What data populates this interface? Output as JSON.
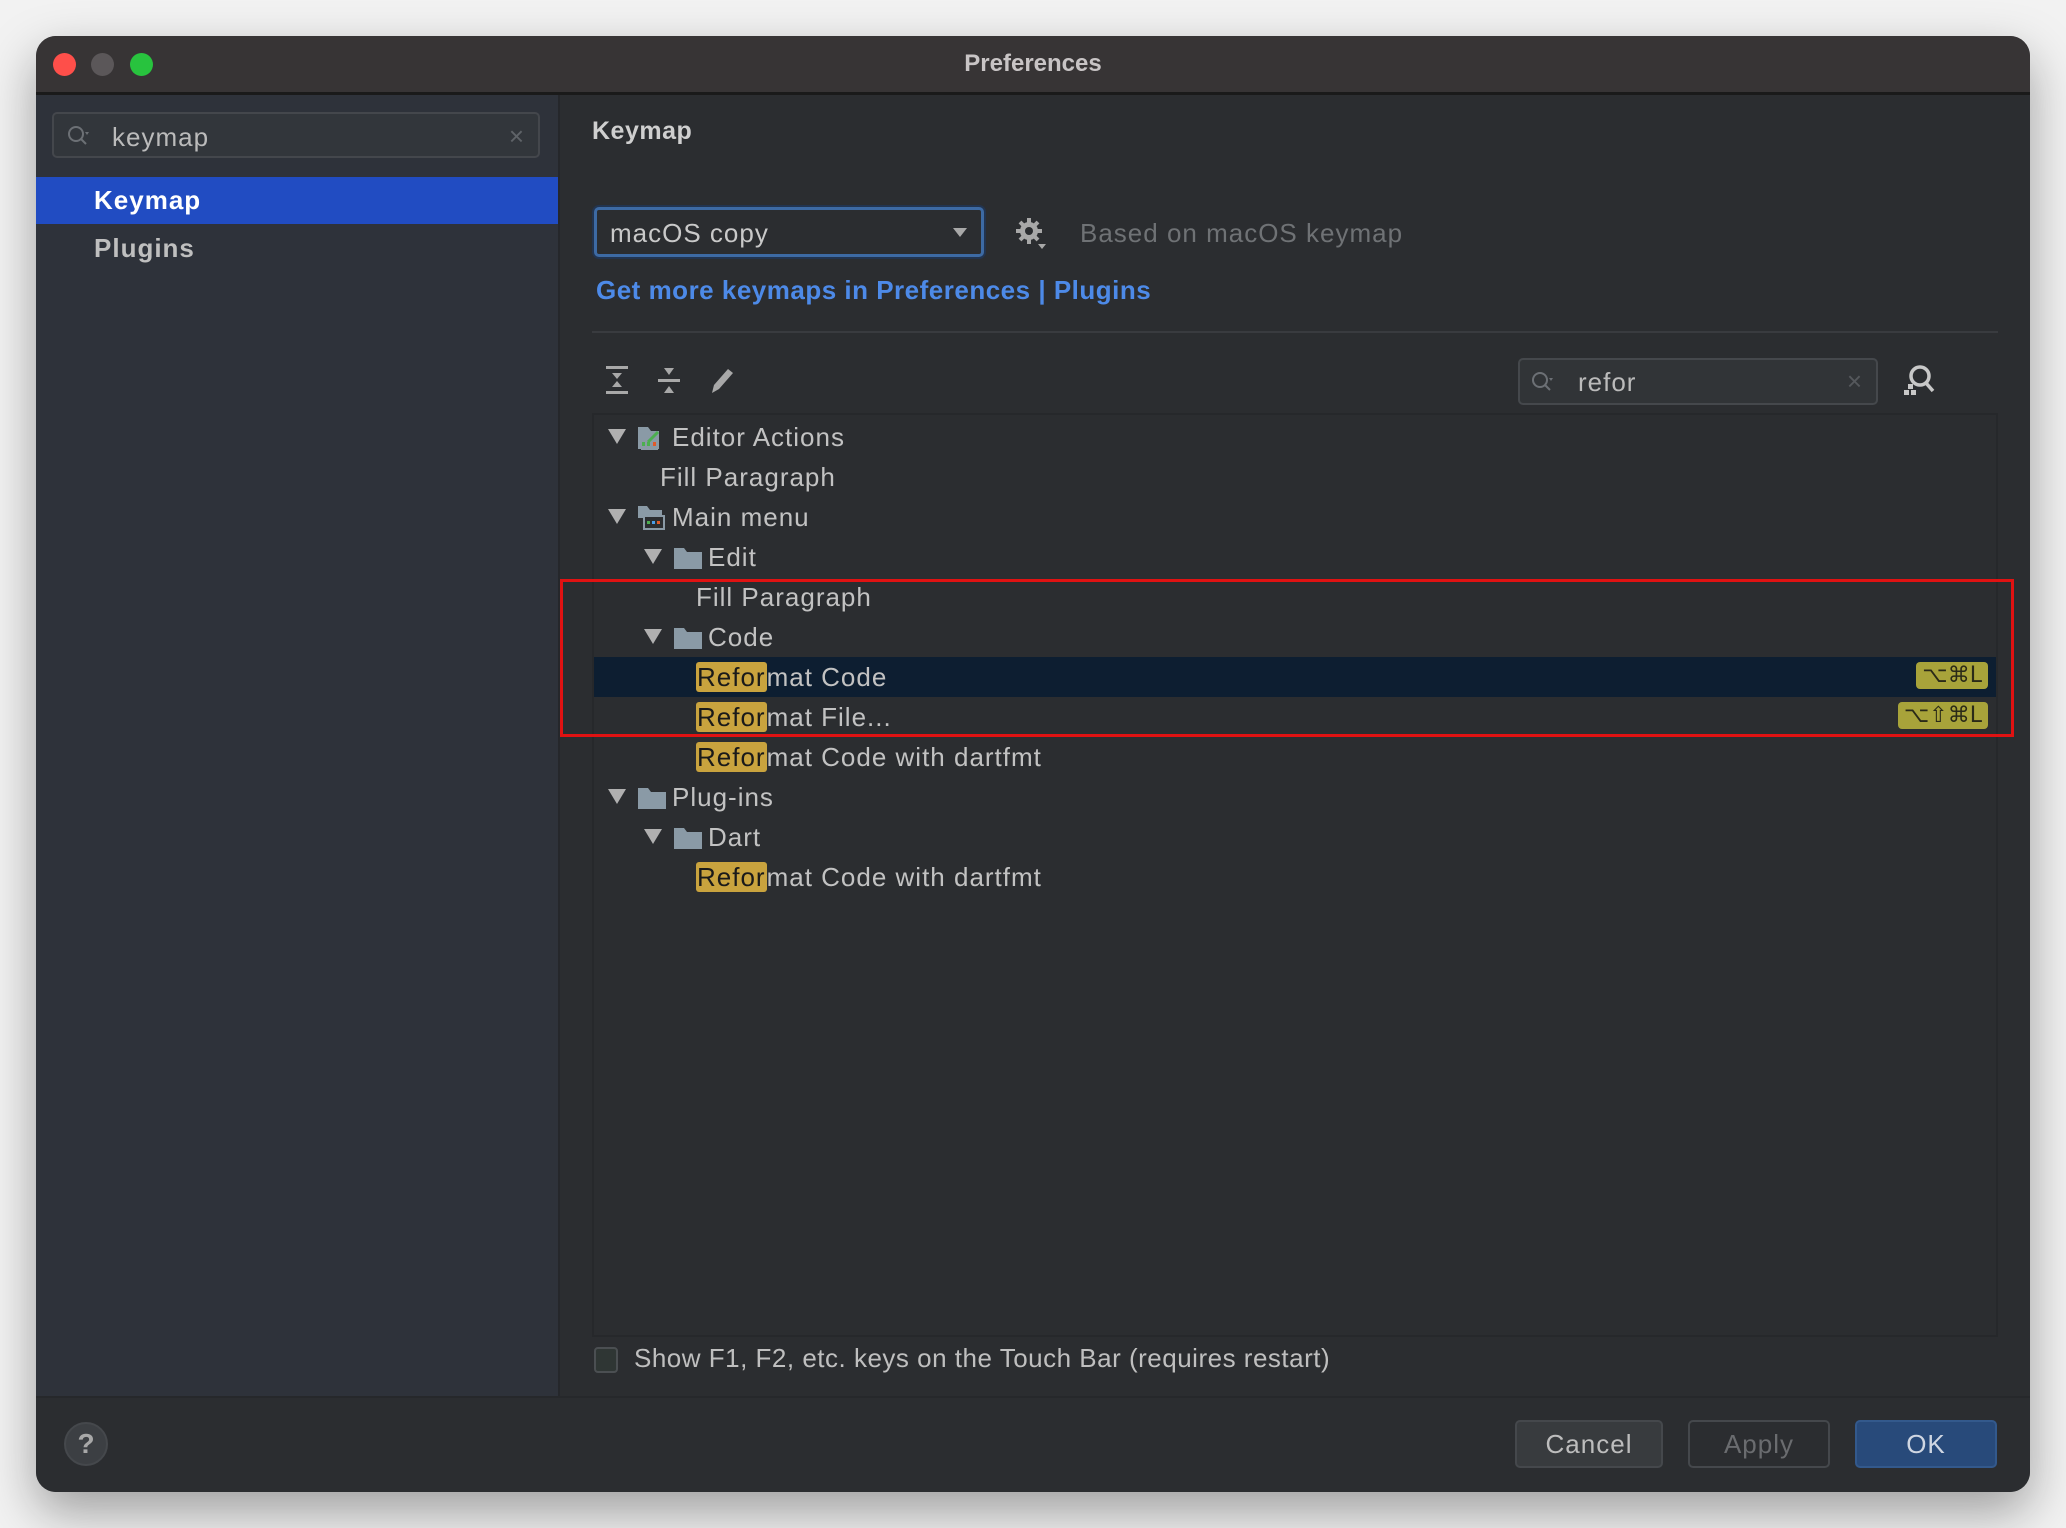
{
  "window": {
    "title": "Preferences"
  },
  "sidebar": {
    "search": {
      "value": "keymap",
      "icon": "search-icon",
      "clear_icon": "×"
    },
    "items": [
      {
        "label": "Keymap",
        "active": true
      },
      {
        "label": "Plugins",
        "active": false
      }
    ]
  },
  "main": {
    "section_title": "Keymap",
    "keymap_select": {
      "value": "macOS copy"
    },
    "gear_icon": "gear-icon",
    "based_on": "Based on macOS keymap",
    "more_link": "Get more keymaps in Preferences | Plugins",
    "toolbar": {
      "expand_all": "expand-all-icon",
      "collapse_all": "collapse-all-icon",
      "edit": "pencil-icon"
    },
    "tree_search": {
      "value": "refor",
      "clear_icon": "×"
    },
    "tree": [
      {
        "label": "Editor Actions",
        "level": 0,
        "type": "group-editor",
        "expanded": true
      },
      {
        "label": "Fill Paragraph",
        "level": 1,
        "type": "action"
      },
      {
        "label": "Main menu",
        "level": 0,
        "type": "group-menu",
        "expanded": true
      },
      {
        "label": "Edit",
        "level": 1,
        "type": "folder",
        "expanded": true
      },
      {
        "label": "Fill Paragraph",
        "level": 2,
        "type": "action"
      },
      {
        "label": "Code",
        "level": 1,
        "type": "folder",
        "expanded": true
      },
      {
        "match": "Refor",
        "rest": "mat Code",
        "level": 2,
        "type": "action",
        "selected": true,
        "shortcut": "⌥⌘L"
      },
      {
        "match": "Refor",
        "rest": "mat File...",
        "level": 2,
        "type": "action",
        "shortcut": "⌥⇧⌘L"
      },
      {
        "match": "Refor",
        "rest": "mat Code with dartfmt",
        "level": 2,
        "type": "action"
      },
      {
        "label": "Plug-ins",
        "level": 0,
        "type": "folder",
        "expanded": true
      },
      {
        "label": "Dart",
        "level": 1,
        "type": "folder",
        "expanded": true
      },
      {
        "match": "Refor",
        "rest": "mat Code with dartfmt",
        "level": 2,
        "type": "action"
      }
    ],
    "touchbar_checkbox": {
      "label": "Show F1, F2, etc. keys on the Touch Bar (requires restart)",
      "checked": false
    }
  },
  "footer": {
    "help": "?",
    "cancel": "Cancel",
    "apply": "Apply",
    "ok": "OK"
  },
  "colors": {
    "accent": "#214cc2",
    "link": "#4d8ae8",
    "highlight": "#c9a33e",
    "shortcut_badge": "#a8a33a",
    "annotation_box": "#e01212"
  }
}
